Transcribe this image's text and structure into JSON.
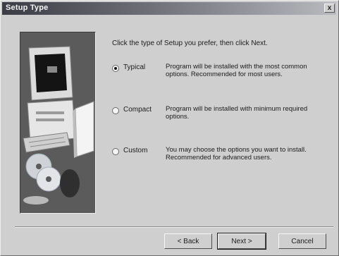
{
  "window": {
    "title": "Setup Type",
    "close_glyph": "x"
  },
  "instruction": "Click the type of Setup you prefer, then click Next.",
  "options": [
    {
      "label": "Typical",
      "description": "Program will be installed with the most common options.  Recommended for most users.",
      "selected": true
    },
    {
      "label": "Compact",
      "description": "Program will be installed with minimum required options.",
      "selected": false
    },
    {
      "label": "Custom",
      "description": "You may choose the options you want to install. Recommended for advanced users.",
      "selected": false
    }
  ],
  "buttons": {
    "back": "< Back",
    "next": "Next >",
    "cancel": "Cancel"
  },
  "artwork": {
    "icon": "computer-with-cds-illustration"
  }
}
